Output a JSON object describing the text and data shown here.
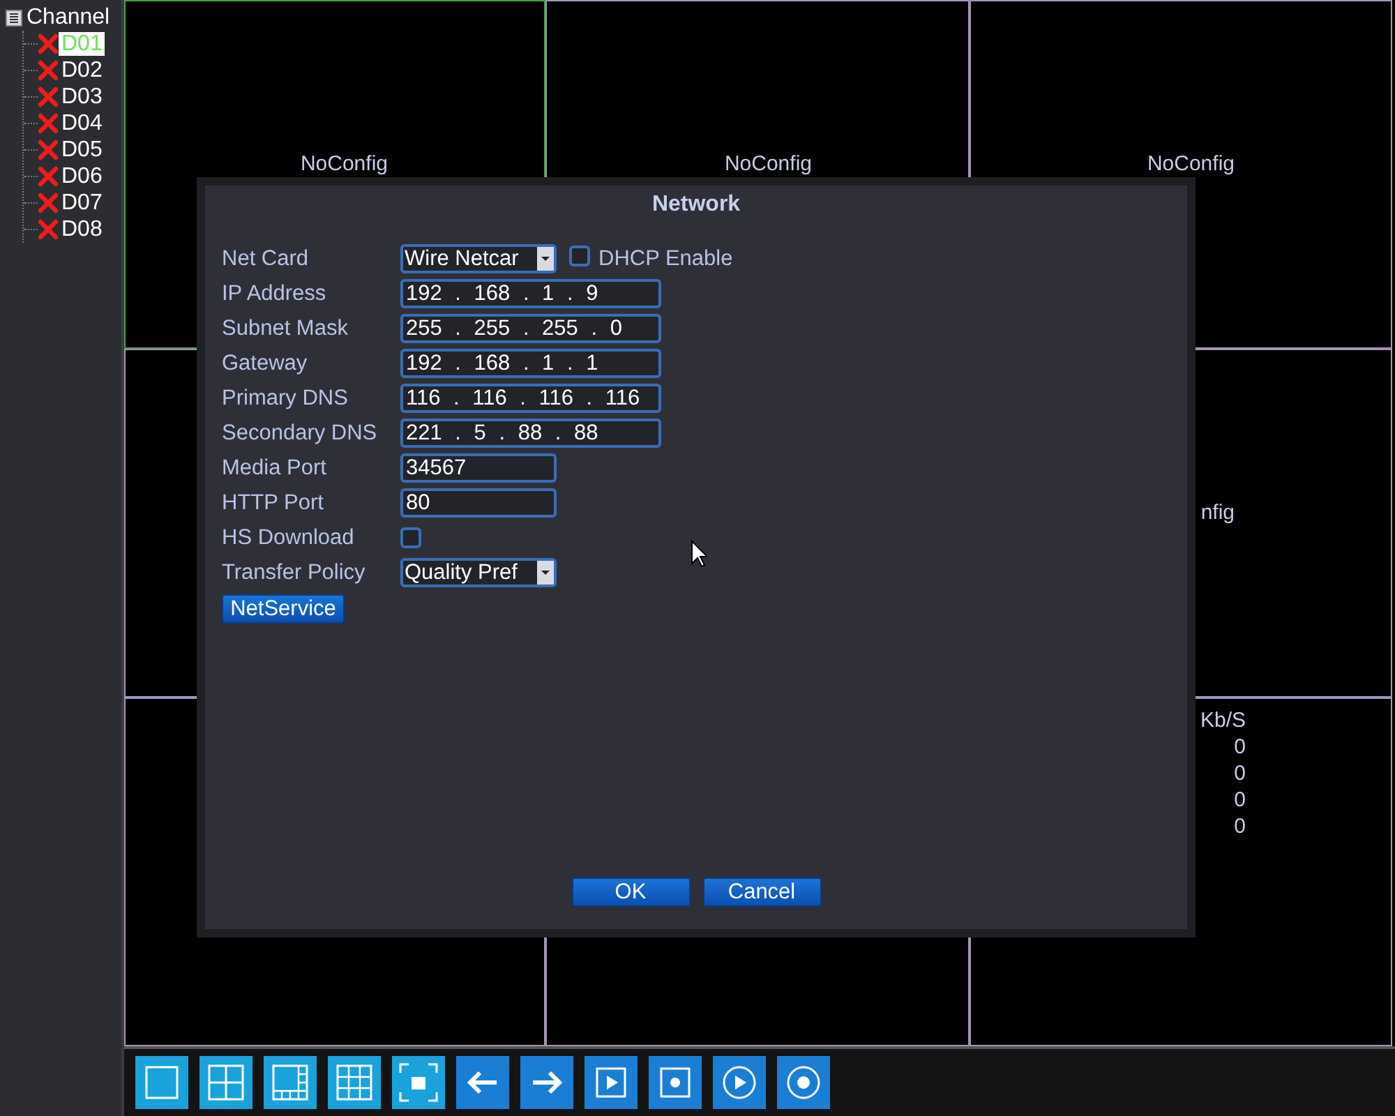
{
  "sidebar": {
    "title": "Channel",
    "items": [
      {
        "label": "D01",
        "selected": true
      },
      {
        "label": "D02",
        "selected": false
      },
      {
        "label": "D03",
        "selected": false
      },
      {
        "label": "D04",
        "selected": false
      },
      {
        "label": "D05",
        "selected": false
      },
      {
        "label": "D06",
        "selected": false
      },
      {
        "label": "D07",
        "selected": false
      },
      {
        "label": "D08",
        "selected": false
      }
    ]
  },
  "video_grid": {
    "cells": [
      {
        "selected": true,
        "label": "NoConfig"
      },
      {
        "selected": false,
        "label": "NoConfig"
      },
      {
        "selected": false,
        "label": "NoConfig"
      },
      {
        "selected": false
      },
      {},
      {
        "selected": false,
        "label": "nfig"
      },
      {
        "selected": false
      },
      {
        "selected": false
      },
      {
        "selected": false,
        "stats": {
          "header": "Kb/S",
          "values": [
            "0",
            "0",
            "0",
            "0"
          ]
        }
      }
    ]
  },
  "dialog": {
    "title": "Network",
    "rows": [
      {
        "kind": "select",
        "label": "Net Card",
        "value": "Wire Netcar",
        "option": {
          "label": "DHCP Enable",
          "checked": false
        }
      },
      {
        "kind": "ip",
        "label": "IP Address",
        "value": "192 . 168 . 1 . 9"
      },
      {
        "kind": "ip",
        "label": "Subnet Mask",
        "value": "255 . 255 . 255 . 0"
      },
      {
        "kind": "ip",
        "label": "Gateway",
        "value": "192 . 168 . 1 . 1"
      },
      {
        "kind": "ip",
        "label": "Primary DNS",
        "value": "116 . 116 . 116 . 116"
      },
      {
        "kind": "ip",
        "label": "Secondary DNS",
        "value": "221 . 5 . 88 . 88"
      },
      {
        "kind": "text",
        "label": "Media Port",
        "value": "34567"
      },
      {
        "kind": "text",
        "label": "HTTP Port",
        "value": "80"
      },
      {
        "kind": "checkbox",
        "label": "HS Download",
        "checked": false
      },
      {
        "kind": "select",
        "label": "Transfer Policy",
        "value": "Quality Pref"
      }
    ],
    "service_button": "NetService",
    "buttons": [
      "OK",
      "Cancel"
    ]
  },
  "toolbar": [
    {
      "kind": "single"
    },
    {
      "kind": "quad"
    },
    {
      "kind": "six"
    },
    {
      "kind": "nine"
    },
    {
      "kind": "full"
    },
    {
      "kind": "prev"
    },
    {
      "kind": "next"
    },
    {
      "kind": "play"
    },
    {
      "kind": "record"
    },
    {
      "kind": "play-circle"
    },
    {
      "kind": "record-circle"
    }
  ]
}
